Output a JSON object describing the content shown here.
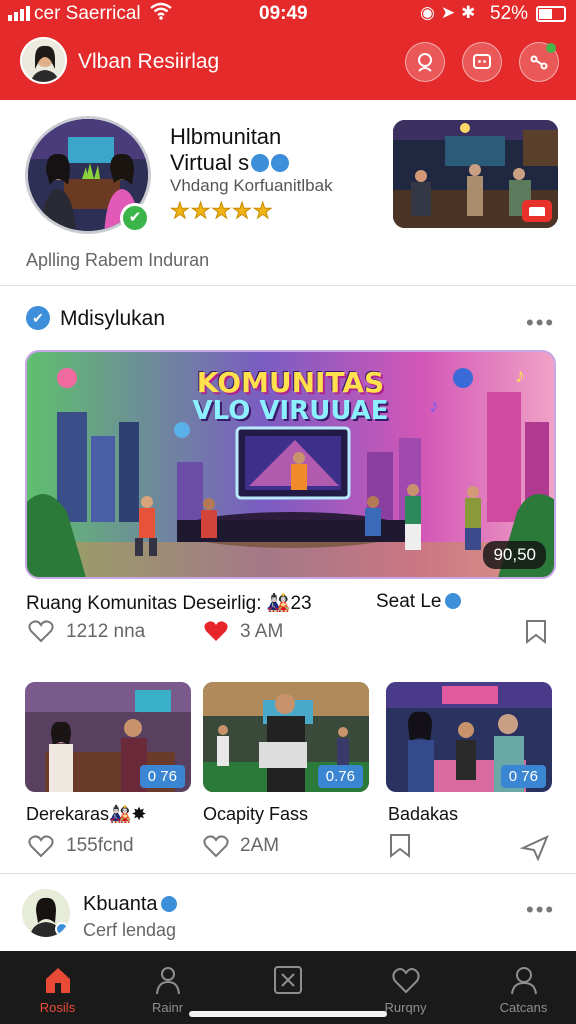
{
  "status_bar": {
    "carrier": "cer Saerrical",
    "time": "09:49",
    "battery": "52%"
  },
  "header": {
    "title": "Vlban Resiirlag",
    "accent": "#e42a2a"
  },
  "profile": {
    "name_line1": "Hlbmunitan",
    "name_line2": "Virtual s",
    "subtitle": "Vhdang Korfuanitlbak",
    "stars": "★★★★★",
    "meta": "Aplling Rabem Induran",
    "avatar_check": "✔"
  },
  "section": {
    "title": "Mdisylukan",
    "check": "✔",
    "more": "•••"
  },
  "hero": {
    "title_line1": "KOMUNITAS",
    "title_line2": "VLO VIRUUAE",
    "time": "90,50"
  },
  "featured_post": {
    "title": "Ruang Komunitas Deseirlig: 🎎23",
    "side_label": "Seat Le",
    "likes": "1212 nna",
    "hearts": "3 AM"
  },
  "cards": [
    {
      "time": "0 76",
      "title": "Derekaras🎎✸",
      "stat": "155fcnd"
    },
    {
      "time": "0.76",
      "title": "Ocapity Fass",
      "stat": "2AM"
    },
    {
      "time": "0 76",
      "title": "Badakas",
      "stat": ""
    }
  ],
  "user": {
    "name": "Kbuanta",
    "sub": "Cerf lendag",
    "more": "•••"
  },
  "tabs": [
    {
      "label": "Rosils",
      "icon": "home-icon",
      "active": true
    },
    {
      "label": "Rainr",
      "icon": "person-icon",
      "active": false
    },
    {
      "label": "",
      "icon": "tools-icon",
      "active": false
    },
    {
      "label": "Rurqny",
      "icon": "heart-icon",
      "active": false
    },
    {
      "label": "Catcans",
      "icon": "profile-icon",
      "active": false
    }
  ],
  "colors": {
    "accent": "#e42a2a",
    "verified": "#3c8fd8",
    "tabbar": "#1a1a1a",
    "card_badge": "#3b86d3"
  }
}
